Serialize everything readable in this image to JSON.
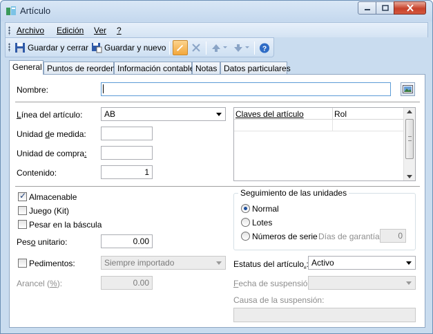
{
  "window": {
    "title": "Artículo"
  },
  "menu": {
    "items": [
      "Archivo",
      "Edición",
      "Ver",
      "?"
    ]
  },
  "toolbar": {
    "save_close": "Guardar y cerrar",
    "save_new": "Guardar y nuevo"
  },
  "tabs": [
    "General",
    "Puntos de reorden",
    "Información contable",
    "Notas",
    "Datos particulares"
  ],
  "general": {
    "nombre_label": "Nombre:",
    "nombre_value": "",
    "linea_label": "Línea del artículo:",
    "linea_value": "AB",
    "unidad_medida_label": "Unidad de medida:",
    "unidad_medida_value": "",
    "unidad_compra_label": "Unidad de compra:",
    "unidad_compra_value": "",
    "contenido_label": "Contenido:",
    "contenido_value": "1",
    "claves_grid": {
      "columns": [
        "Claves del artículo",
        "Rol"
      ]
    },
    "almacenable_label": "Almacenable",
    "almacenable_checked": true,
    "juego_label": "Juego (Kit)",
    "juego_checked": false,
    "pesar_label": "Pesar en la báscula",
    "pesar_checked": false,
    "peso_label": "Peso unitario:",
    "peso_value": "0.00",
    "pedimentos_label": "Pedimentos:",
    "pedimentos_checked": false,
    "pedimentos_value": "Siempre importado",
    "arancel_label": "Arancel (%):",
    "arancel_value": "0.00",
    "seguimiento": {
      "title": "Seguimiento de las unidades",
      "options": [
        "Normal",
        "Lotes",
        "Números de serie"
      ],
      "selected": "Normal",
      "garantia_label": "Días de garantía:",
      "garantia_value": "0"
    },
    "estatus_label": "Estatus del artículo.:",
    "estatus_value": "Activo",
    "fecha_susp_label": "Fecha de suspensión:",
    "fecha_susp_value": "",
    "causa_susp_label": "Causa de la suspensión:",
    "causa_susp_value": ""
  }
}
